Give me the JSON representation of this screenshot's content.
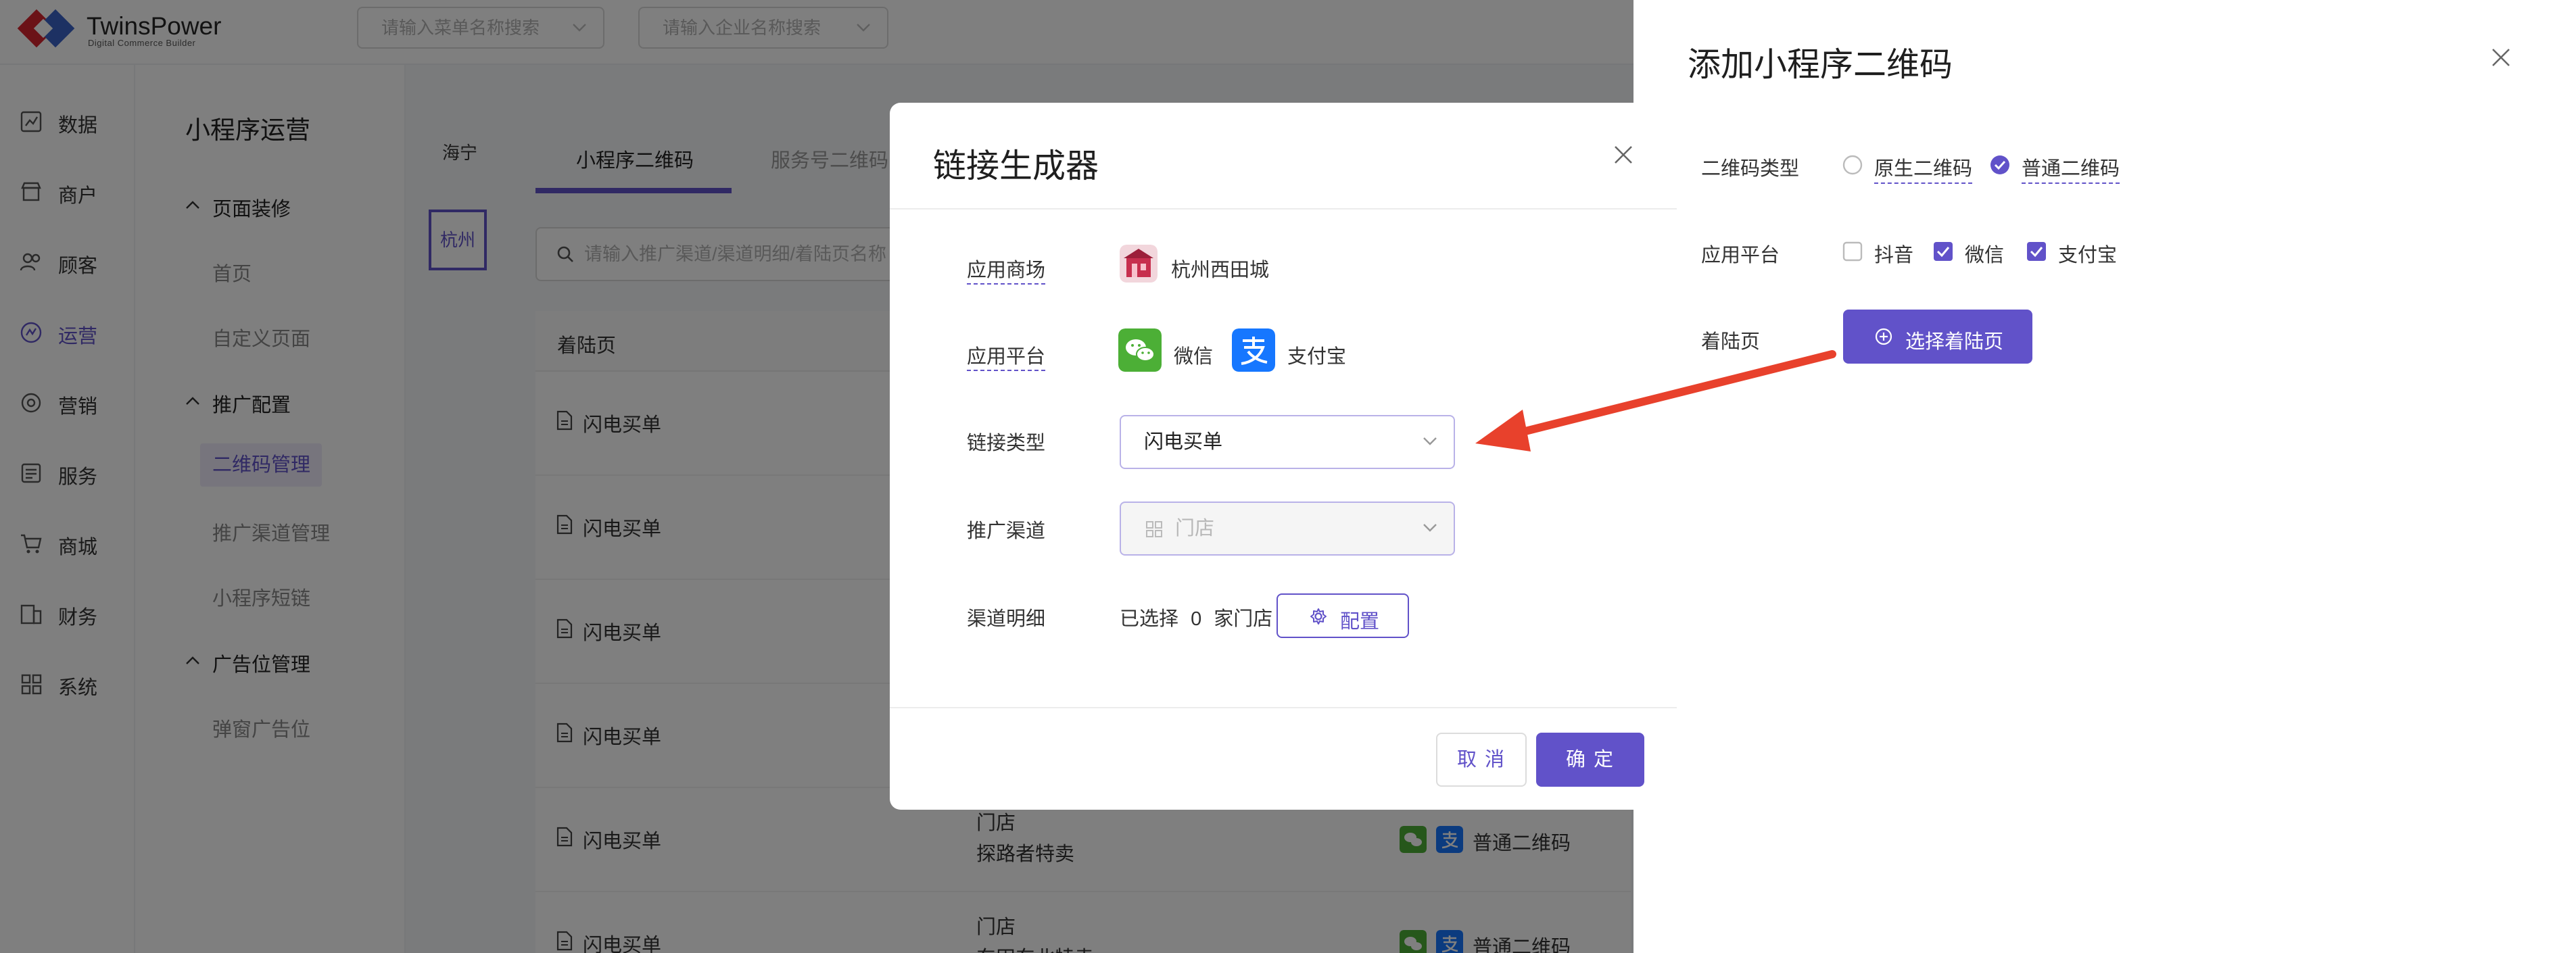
{
  "app": {
    "logo_name": "TwinsPower",
    "logo_subtitle": "Digital Commerce Builder"
  },
  "header": {
    "menu_search_placeholder": "请输入菜单名称搜索",
    "company_search_placeholder": "请输入企业名称搜索"
  },
  "leftnav": {
    "items": [
      {
        "label": "数据",
        "icon": "chart-icon"
      },
      {
        "label": "商户",
        "icon": "store-icon"
      },
      {
        "label": "顾客",
        "icon": "users-icon"
      },
      {
        "label": "运营",
        "icon": "operations-icon",
        "active": true
      },
      {
        "label": "营销",
        "icon": "marketing-icon"
      },
      {
        "label": "服务",
        "icon": "service-icon"
      },
      {
        "label": "商城",
        "icon": "cart-icon"
      },
      {
        "label": "财务",
        "icon": "finance-icon"
      },
      {
        "label": "系统",
        "icon": "grid-icon"
      }
    ]
  },
  "subnav": {
    "title": "小程序运营",
    "groups": [
      {
        "label": "页面装修",
        "items": [
          "首页",
          "自定义页面"
        ]
      },
      {
        "label": "推广配置",
        "items": [
          "二维码管理",
          "推广渠道管理",
          "小程序短链"
        ]
      },
      {
        "label": "广告位管理",
        "items": [
          "弹窗广告位"
        ]
      }
    ],
    "active_item": "二维码管理"
  },
  "main": {
    "cities": [
      "海宁",
      "杭州"
    ],
    "selected_city": "杭州",
    "tabs": [
      "小程序二维码",
      "服务号二维码"
    ],
    "search_placeholder": "请输入推广渠道/渠道明细/着陆页名称",
    "table": {
      "header_landing": "着陆页",
      "rows": [
        {
          "landing": "闪电买单",
          "channel": "",
          "channel_detail": "",
          "plat_label": ""
        },
        {
          "landing": "闪电买单",
          "channel": "",
          "channel_detail": "",
          "plat_label": ""
        },
        {
          "landing": "闪电买单",
          "channel": "",
          "channel_detail": "",
          "plat_label": ""
        },
        {
          "landing": "闪电买单",
          "channel": "",
          "channel_detail": "",
          "plat_label": ""
        },
        {
          "landing": "闪电买单",
          "channel": "门店",
          "channel_detail": "探路者特卖",
          "plat_label": "普通二维码"
        },
        {
          "landing": "闪电买单",
          "channel": "门店",
          "channel_detail": "东田东北特卖",
          "plat_label": "普通二维码"
        }
      ]
    }
  },
  "drawer": {
    "title": "添加小程序二维码",
    "qr_type_label": "二维码类型",
    "qr_type_options": [
      {
        "label": "原生二维码",
        "checked": false
      },
      {
        "label": "普通二维码",
        "checked": true
      }
    ],
    "platform_label": "应用平台",
    "platform_options": [
      {
        "label": "抖音",
        "checked": false
      },
      {
        "label": "微信",
        "checked": true
      },
      {
        "label": "支付宝",
        "checked": true
      }
    ],
    "landing_label": "着陆页",
    "pick_landing_button": "选择着陆页"
  },
  "modal": {
    "title": "链接生成器",
    "store_label": "应用商场",
    "store_name": "杭州西田城",
    "platform_label": "应用平台",
    "platforms": [
      {
        "name": "微信",
        "icon": "wechat-icon",
        "color": "#4caf36"
      },
      {
        "name": "支付宝",
        "icon": "alipay-icon",
        "color": "#1677ff"
      }
    ],
    "link_type_label": "链接类型",
    "link_type_value": "闪电买单",
    "channel_label": "推广渠道",
    "channel_value": "门店",
    "channel_detail_label": "渠道明细",
    "selected_prefix": "已选择",
    "selected_count": "0",
    "selected_suffix": "家门店",
    "config_button": "配置",
    "cancel_button": "取 消",
    "ok_button": "确 定"
  },
  "colors": {
    "accent": "#6152c9",
    "wechat": "#4caf36",
    "alipay": "#1677ff",
    "arrow": "#e8412c"
  }
}
